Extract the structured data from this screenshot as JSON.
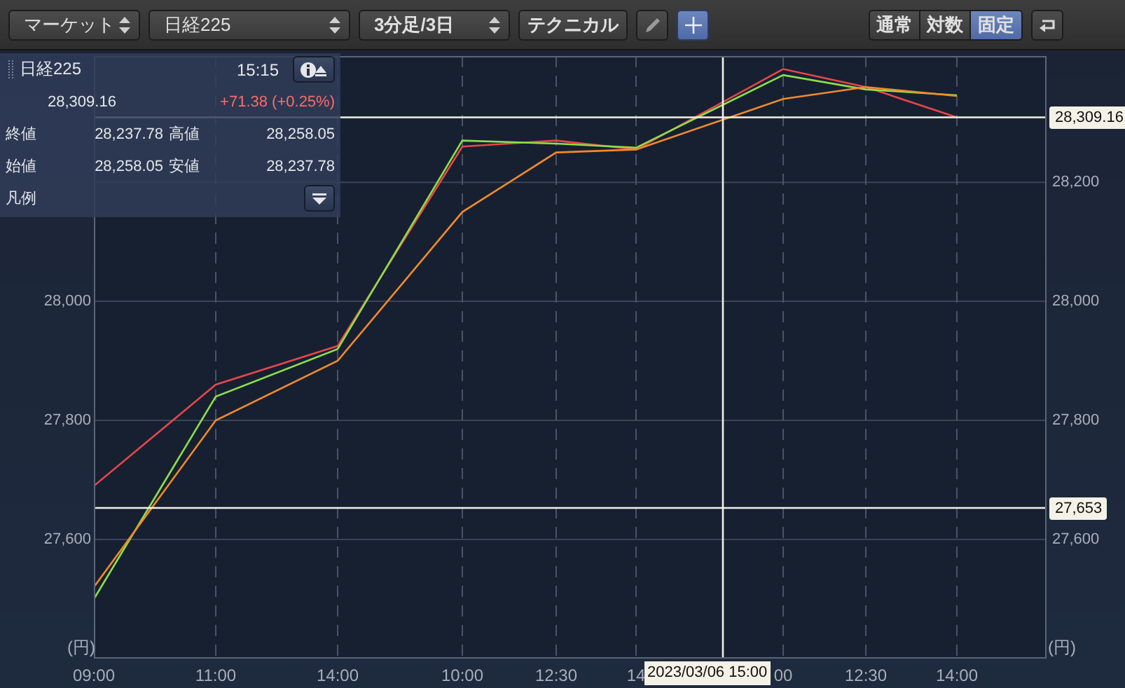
{
  "toolbar": {
    "selects": [
      {
        "value": "マーケット"
      },
      {
        "value": "日経225"
      },
      {
        "value": "3分足/3日"
      }
    ],
    "technical_button": "テクニカル",
    "tools": [
      {
        "kind": "pencil",
        "selected": false
      },
      {
        "kind": "crosshair",
        "selected": true
      }
    ],
    "scale_modes": [
      {
        "label": "通常",
        "selected": false
      },
      {
        "label": "対数",
        "selected": false
      },
      {
        "label": "固定",
        "selected": true
      }
    ]
  },
  "info_panel": {
    "symbol": "日経225",
    "time": "15:15",
    "price": "28,309.16",
    "change": "+71.38 (+0.25%)",
    "rows": [
      {
        "label": "終値",
        "value": "28,237.78",
        "label2": "高値",
        "value2": "28,258.05"
      },
      {
        "label": "始値",
        "value": "28,258.05",
        "label2": "安値",
        "value2": "28,237.78"
      }
    ],
    "legend_label": "凡例"
  },
  "chart": {
    "unit_left": "(円)",
    "unit_right": "(円)",
    "left_axis_labels": [
      {
        "label": "28,000"
      },
      {
        "label": "27,800"
      },
      {
        "label": "27,600"
      }
    ],
    "chart_data": {
      "type": "line",
      "categories": [
        "09:00",
        "11:00",
        "14:00",
        "10:00",
        "12:30",
        "14",
        "00",
        "12:30",
        "14:00"
      ],
      "series": [
        {
          "color": "#e8464a",
          "values": [
            27690,
            27860,
            27925,
            28260,
            28270,
            28255,
            28390,
            28360,
            28309
          ]
        },
        {
          "color": "#8be04a",
          "values": [
            27500,
            27840,
            27920,
            28270,
            28265,
            28258,
            28380,
            28356,
            28346
          ]
        },
        {
          "color": "#f08a2a",
          "values": [
            27520,
            27800,
            27900,
            28150,
            28250,
            28255,
            28340,
            28360,
            28345
          ]
        }
      ],
      "ylim": [
        27400,
        28412
      ],
      "grid": true,
      "yticks": [
        {
          "value": 28200,
          "label": "28,200"
        },
        {
          "value": 28000,
          "label": "28,000"
        },
        {
          "value": 27800,
          "label": "27,800"
        },
        {
          "value": 27600,
          "label": "27,600"
        }
      ],
      "annotations": [
        "28,309.16",
        {
          "text": "27,653",
          "y": 27653
        },
        {
          "text": "2023/03/06 15:00"
        }
      ]
    }
  }
}
